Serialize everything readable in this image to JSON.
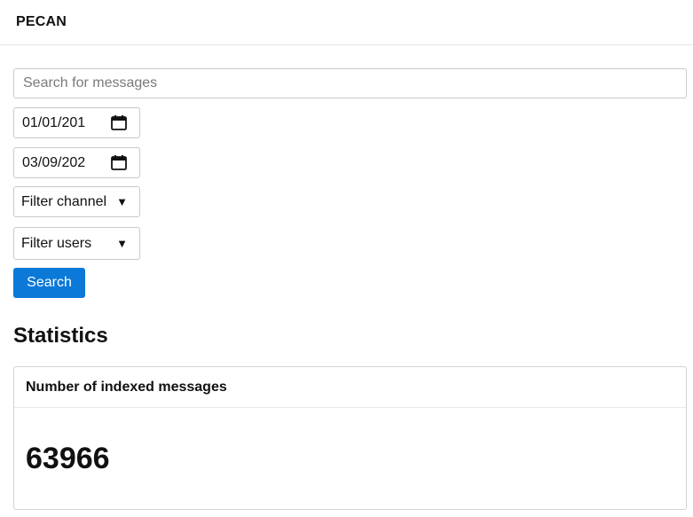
{
  "navbar": {
    "brand": "PECAN"
  },
  "search": {
    "placeholder": "Search for messages",
    "value": ""
  },
  "filters": {
    "start_date": "01/01/201",
    "end_date": "03/09/202",
    "channel_label": "Filter channel",
    "users_label": "Filter users",
    "caret": "▼"
  },
  "search_button": {
    "label": "Search"
  },
  "statistics": {
    "title": "Statistics",
    "card": {
      "header": "Number of indexed messages",
      "value": "63966"
    }
  },
  "colors": {
    "accent": "#0b79d8",
    "border": "#c9c9c9"
  },
  "icons": {
    "date_fields": "calendar-icon",
    "select_fields": "caret-down-icon"
  }
}
